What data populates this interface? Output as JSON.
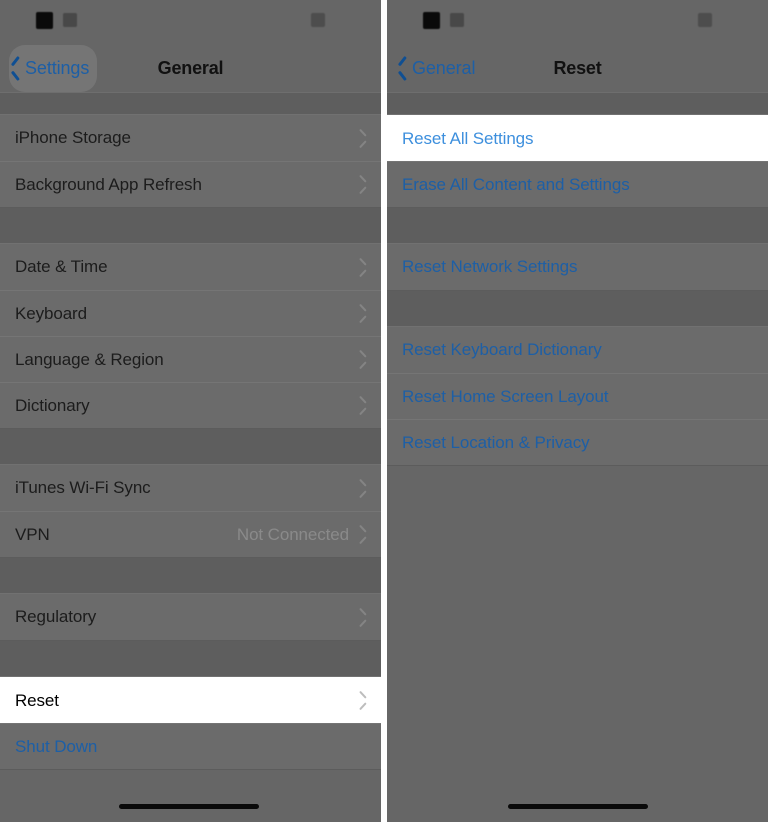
{
  "screens": [
    {
      "id": "general-screen",
      "statusbar": {
        "time_redacted": "time-redacted",
        "location_redacted": "location-indicator-redacted",
        "battery_redacted": "battery-redacted"
      },
      "nav": {
        "back_label": "Settings",
        "title": "General"
      },
      "groups": [
        {
          "rows": [
            {
              "label": "iPhone Storage",
              "value": "",
              "chevron": true,
              "style": "normal",
              "highlight": false
            },
            {
              "label": "Background App Refresh",
              "value": "",
              "chevron": true,
              "style": "normal",
              "highlight": false
            }
          ]
        },
        {
          "rows": [
            {
              "label": "Date & Time",
              "value": "",
              "chevron": true,
              "style": "normal",
              "highlight": false
            },
            {
              "label": "Keyboard",
              "value": "",
              "chevron": true,
              "style": "normal",
              "highlight": false
            },
            {
              "label": "Language & Region",
              "value": "",
              "chevron": true,
              "style": "normal",
              "highlight": false
            },
            {
              "label": "Dictionary",
              "value": "",
              "chevron": true,
              "style": "normal",
              "highlight": false
            }
          ]
        },
        {
          "rows": [
            {
              "label": "iTunes Wi-Fi Sync",
              "value": "",
              "chevron": true,
              "style": "normal",
              "highlight": false
            },
            {
              "label": "VPN",
              "value": "Not Connected",
              "chevron": true,
              "style": "normal",
              "highlight": false
            }
          ]
        },
        {
          "rows": [
            {
              "label": "Regulatory",
              "value": "",
              "chevron": true,
              "style": "normal",
              "highlight": false
            }
          ]
        },
        {
          "rows": [
            {
              "label": "Reset",
              "value": "",
              "chevron": true,
              "style": "normal",
              "highlight": true
            },
            {
              "label": "Shut Down",
              "value": "",
              "chevron": false,
              "style": "action",
              "highlight": false
            }
          ]
        }
      ]
    },
    {
      "id": "reset-screen",
      "statusbar": {
        "time_redacted": "time-redacted",
        "location_redacted": "location-indicator-redacted",
        "battery_redacted": "battery-redacted"
      },
      "nav": {
        "back_label": "General",
        "title": "Reset"
      },
      "groups": [
        {
          "rows": [
            {
              "label": "Reset All Settings",
              "value": "",
              "chevron": false,
              "style": "action",
              "highlight": true
            },
            {
              "label": "Erase All Content and Settings",
              "value": "",
              "chevron": false,
              "style": "action",
              "highlight": false
            }
          ]
        },
        {
          "rows": [
            {
              "label": "Reset Network Settings",
              "value": "",
              "chevron": false,
              "style": "action",
              "highlight": false
            }
          ]
        },
        {
          "rows": [
            {
              "label": "Reset Keyboard Dictionary",
              "value": "",
              "chevron": false,
              "style": "action",
              "highlight": false
            },
            {
              "label": "Reset Home Screen Layout",
              "value": "",
              "chevron": false,
              "style": "action",
              "highlight": false
            },
            {
              "label": "Reset Location & Privacy",
              "value": "",
              "chevron": false,
              "style": "action",
              "highlight": false
            }
          ]
        }
      ]
    }
  ],
  "colors": {
    "dim_overlay": "#666666",
    "row_dim": "#6b6b6b",
    "group_gap": "#5e5e5e",
    "highlight_bg": "#ffffff",
    "link_blue_dim": "#1d5fa6",
    "link_blue_bright": "#3d8fdd",
    "title_text": "#111111",
    "value_text": "#8a8a8a"
  }
}
